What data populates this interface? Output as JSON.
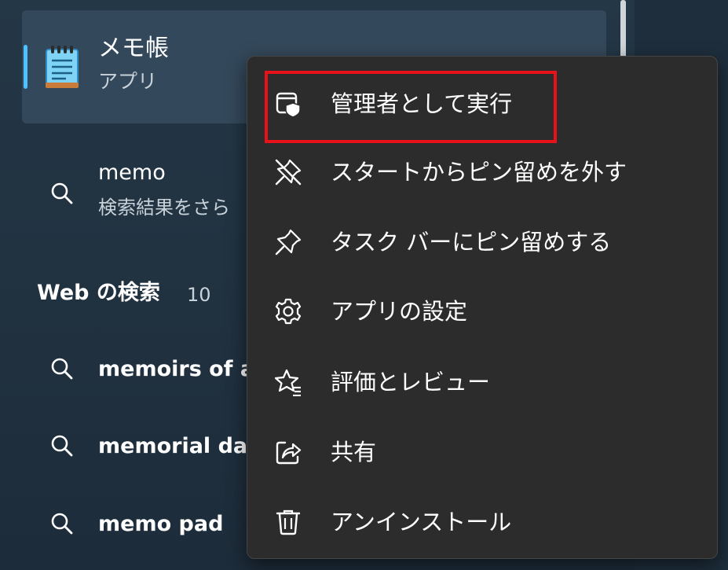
{
  "colors": {
    "accent": "#4cc2ff",
    "highlight": "#e8121b",
    "menu_background": "#2c2c2c",
    "selected_result": "#33485a"
  },
  "best_match": {
    "name": "メモ帳",
    "type": "アプリ",
    "icon": "notepad-icon"
  },
  "search_suggestion": {
    "title": "memo",
    "subtitle": "検索結果をさら",
    "icon": "search-icon"
  },
  "web_section": {
    "heading": "Web の検索",
    "count": "10",
    "items": [
      {
        "label": "memoirs of a",
        "icon": "search-icon"
      },
      {
        "label": "memorial day",
        "icon": "search-icon"
      },
      {
        "label": "memo pad",
        "icon": "search-icon"
      }
    ]
  },
  "context_menu": {
    "items": [
      {
        "label": "管理者として実行",
        "icon": "run-as-admin-shield-icon"
      },
      {
        "label": "スタートからピン留めを外す",
        "icon": "unpin-icon"
      },
      {
        "label": "タスク バーにピン留めする",
        "icon": "pin-icon"
      },
      {
        "label": "アプリの設定",
        "icon": "gear-icon"
      },
      {
        "label": "評価とレビュー",
        "icon": "star-rating-icon"
      },
      {
        "label": "共有",
        "icon": "share-icon"
      },
      {
        "label": "アンインストール",
        "icon": "trash-icon"
      }
    ]
  }
}
